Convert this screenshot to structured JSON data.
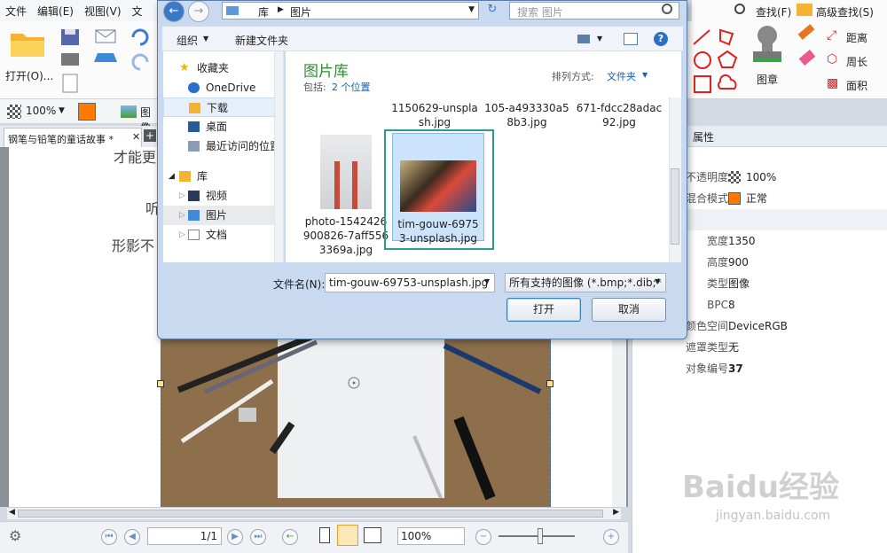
{
  "menu": {
    "items": [
      "文件",
      "编辑(E)",
      "视图(V)",
      "文"
    ]
  },
  "ribbon": {
    "open_label": "打开(O)...",
    "find_label": "查找(F)",
    "adv_find_label": "高级查找(S)",
    "stamp_label": "图章",
    "distance_label": "距离",
    "perimeter_label": "周长",
    "area_label": "面积"
  },
  "propstrip": {
    "opacity": "100%",
    "image_label": "图像"
  },
  "doc_tab": {
    "title": "钢笔与铅笔的童话故事 *"
  },
  "doc_text": {
    "line1": "才能更",
    "line2": "听",
    "line3": "形影不"
  },
  "statusbar": {
    "page": "1/1",
    "zoom": "100%"
  },
  "props": {
    "title": "属性",
    "rows": [
      {
        "k": "不透明度",
        "v": "100%"
      },
      {
        "k": "混合模式",
        "v": "正常"
      },
      {
        "k": "",
        "v": ""
      },
      {
        "k": "宽度",
        "v": "1350"
      },
      {
        "k": "高度",
        "v": "900"
      },
      {
        "k": "类型",
        "v": "图像"
      },
      {
        "k": "BPC",
        "v": "8"
      },
      {
        "k": "颜色空间",
        "v": "DeviceRGB"
      },
      {
        "k": "遮罩类型",
        "v": "无"
      },
      {
        "k": "对象编号",
        "v": "37"
      }
    ]
  },
  "dialog": {
    "address_path": [
      "库",
      "图片"
    ],
    "search_placeholder": "搜索 图片",
    "organize_label": "组织",
    "new_folder_label": "新建文件夹",
    "nav": {
      "favorites": "收藏夹",
      "onedrive": "OneDrive",
      "downloads": "下载",
      "desktop": "桌面",
      "recent": "最近访问的位置",
      "libraries": "库",
      "videos": "视频",
      "pictures": "图片",
      "documents": "文档"
    },
    "library_title": "图片库",
    "includes_label": "包括:",
    "includes_link": "2 个位置",
    "sort_label": "排列方式:",
    "sort_value": "文件夹",
    "files_top": [
      {
        "line1": "1150629-unspla",
        "line2": "sh.jpg"
      },
      {
        "line1": "105-a493330a5",
        "line2": "8b3.jpg"
      },
      {
        "line1": "671-fdcc28adac",
        "line2": "92.jpg"
      }
    ],
    "file1": {
      "line1": "photo-1542426",
      "line2": "900826-7aff556",
      "line3": "3369a.jpg"
    },
    "file2": {
      "line1": "tim-gouw-6975",
      "line2": "3-unsplash.jpg"
    },
    "filename_label": "文件名(N):",
    "filename_value": "tim-gouw-69753-unsplash.jpg",
    "filetype_value": "所有支持的图像 (*.bmp;*.dib;*",
    "open_button": "打开",
    "cancel_button": "取消"
  },
  "watermark": {
    "brand": "Baidu经验",
    "url": "jingyan.baidu.com"
  },
  "colors": {
    "accent": "#2e8fd0",
    "library_green": "#2f8f2f",
    "selection_border": "#2a9d8f",
    "brand_orange": "#ff6a00"
  }
}
